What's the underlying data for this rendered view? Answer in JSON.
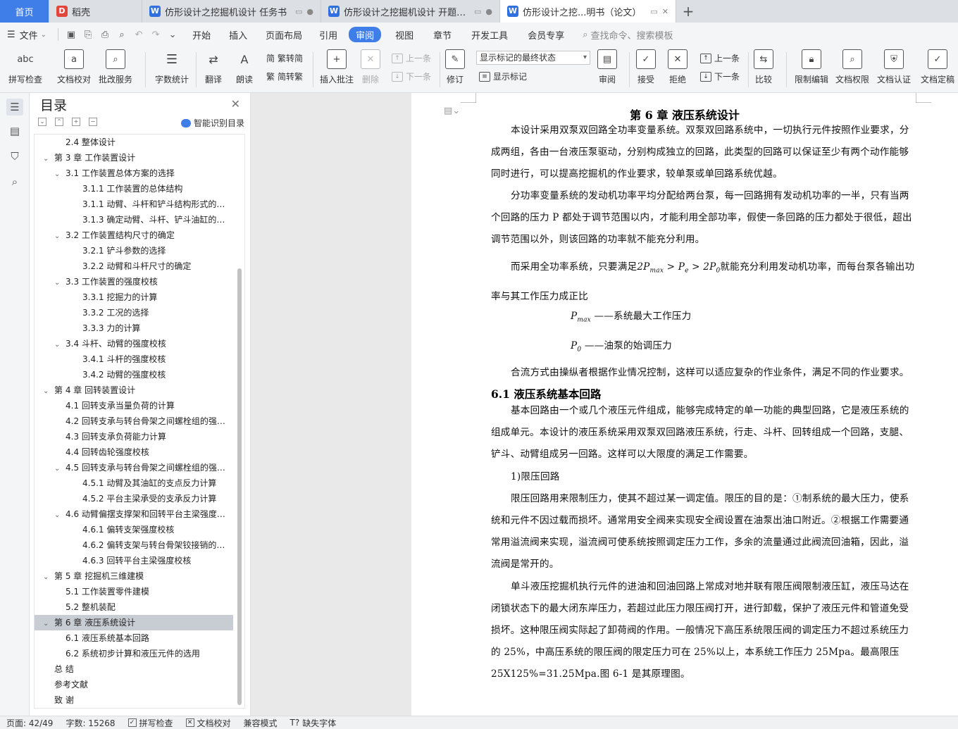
{
  "tabs": {
    "home": "首页",
    "doke": "稻壳",
    "t1": "仿形设计之挖掘机设计 任务书",
    "t2": "仿形设计之挖掘机设计 开题报告",
    "t3": "仿形设计之挖...明书（论文）",
    "doke_icon": "D",
    "word_icon": "W"
  },
  "menubar": {
    "file": "文件",
    "items": [
      "开始",
      "插入",
      "页面布局",
      "引用",
      "审阅",
      "视图",
      "章节",
      "开发工具",
      "会员专享"
    ],
    "active": "审阅",
    "search": "查找命令、搜索模板"
  },
  "ribbon": {
    "spell": "拼写检查",
    "proof": "文档校对",
    "annot_service": "批改服务",
    "wordcount": "字数统计",
    "translate": "翻译",
    "read": "朗读",
    "to_trad": "繁转简",
    "to_simp": "简转繁",
    "insert_comment": "插入批注",
    "delete": "删除",
    "prev": "上一条",
    "next": "下一条",
    "revise": "修订",
    "mark_state": "显示标记的最终状态",
    "show_marks": "显示标记",
    "review": "审阅",
    "accept": "接受",
    "reject": "拒绝",
    "prev2": "上一条",
    "next2": "下一条",
    "compare": "比较",
    "restrict": "限制编辑",
    "perm": "文档权限",
    "cert": "文档认证",
    "final": "文档定稿",
    "spell_icon_text": "abc"
  },
  "toc": {
    "title": "目录",
    "smart": "智能识别目录",
    "items": [
      {
        "level": 2,
        "text": "2.4 整体设计",
        "caret": ""
      },
      {
        "level": 1,
        "text": "第 3 章  工作装置设计",
        "caret": "⌄"
      },
      {
        "level": 2,
        "text": "3.1  工作装置总体方案的选择",
        "caret": "⌄"
      },
      {
        "level": 3,
        "text": "3.1.1 工作装置的总体结构",
        "caret": ""
      },
      {
        "level": 3,
        "text": "3.1.1 动臂、斗杆和铲斗结构形式的选择",
        "caret": ""
      },
      {
        "level": 3,
        "text": "3.1.3 确定动臂、斗杆、铲斗油缸的铰点位置",
        "caret": ""
      },
      {
        "level": 2,
        "text": "3.2 工作装置结构尺寸的确定",
        "caret": "⌄"
      },
      {
        "level": 3,
        "text": "3.2.1 铲斗参数的选择",
        "caret": ""
      },
      {
        "level": 3,
        "text": "3.2.2 动臂和斗杆尺寸的确定",
        "caret": ""
      },
      {
        "level": 2,
        "text": "3.3 工作装置的强度校核",
        "caret": "⌄"
      },
      {
        "level": 3,
        "text": "3.3.1 挖掘力的计算",
        "caret": ""
      },
      {
        "level": 3,
        "text": "3.3.2 工况的选择",
        "caret": ""
      },
      {
        "level": 3,
        "text": "3.3.3 力的计算",
        "caret": ""
      },
      {
        "level": 2,
        "text": "3.4 斗杆、动臂的强度校核",
        "caret": "⌄"
      },
      {
        "level": 3,
        "text": "3.4.1 斗杆的强度校核",
        "caret": ""
      },
      {
        "level": 3,
        "text": "3.4.2 动臂的强度校核",
        "caret": ""
      },
      {
        "level": 1,
        "text": "第 4 章  回转装置设计",
        "caret": "⌄"
      },
      {
        "level": 2,
        "text": "4.1 回转支承当量负荷的计算",
        "caret": ""
      },
      {
        "level": 2,
        "text": "4.2 回转支承与转台骨架之间螺栓组的强度校核",
        "caret": ""
      },
      {
        "level": 2,
        "text": "4.3 回转支承负荷能力计算",
        "caret": ""
      },
      {
        "level": 2,
        "text": "4.4 回转齿轮强度校核",
        "caret": ""
      },
      {
        "level": 2,
        "text": "4.5  回转支承与转台骨架之间螺栓组的强度校核",
        "caret": "⌄"
      },
      {
        "level": 3,
        "text": "4.5.1  动臂及其油缸的支点反力计算",
        "caret": ""
      },
      {
        "level": 3,
        "text": "4.5.2  平台主梁承受的支承反力计算",
        "caret": ""
      },
      {
        "level": 2,
        "text": "4.6 动臂偏摆支撑架和回转平台主梁强度校核",
        "caret": "⌄"
      },
      {
        "level": 3,
        "text": "4.6.1  偏转支架强度校核",
        "caret": ""
      },
      {
        "level": 3,
        "text": "4.6.2  偏转支架与转台骨架铰接销的强度校核",
        "caret": ""
      },
      {
        "level": 3,
        "text": "4.6.3  回转平台主梁强度校核",
        "caret": ""
      },
      {
        "level": 1,
        "text": "第 5 章  挖掘机三维建模",
        "caret": "⌄"
      },
      {
        "level": 2,
        "text": "5.1 工作装置零件建模",
        "caret": ""
      },
      {
        "level": 2,
        "text": "5.2 整机装配",
        "caret": ""
      },
      {
        "level": 1,
        "text": "第 6 章  液压系统设计",
        "caret": "⌄",
        "selected": true
      },
      {
        "level": 2,
        "text": "6.1 液压系统基本回路",
        "caret": ""
      },
      {
        "level": 2,
        "text": "6.2 系统初步计算和液压元件的选用",
        "caret": ""
      },
      {
        "level": 1,
        "text": "总    结",
        "caret": ""
      },
      {
        "level": 1,
        "text": "参考文献",
        "caret": ""
      },
      {
        "level": 1,
        "text": "致    谢",
        "caret": ""
      }
    ]
  },
  "doc": {
    "chapter_title": "第 6 章  液压系统设计",
    "p1": "本设计采用双泵双回路全功率变量系统。双泵双回路系统中，一切执行元件按照作业要求，分成两组，各由一台液压泵驱动，分别构成独立的回路，此类型的回路可以保证至少有两个动作能够同时进行，可以提高挖掘机的作业要求，较单泵或单回路系统优越。",
    "p2": "分功率变量系统的发动机功率平均分配给两台泵，每一回路拥有发动机功率的一半，只有当两个回路的压力 P 都处于调节范围以内，才能利用全部功率，假使一条回路的压力都处于很低，超出调节范围以外，则该回路的功率就不能充分利用。",
    "p3_a": "而采用全功率系统，只要满足",
    "p3_formula": "2P_max > P_e > 2P_0",
    "p3_b": "就能充分利用发动机功率，而每台泵各输出功率与其工作压力成正比",
    "def1_sym": "P",
    "def1_sub": "max",
    "def1_text": " ——系统最大工作压力",
    "def2_sym": "P",
    "def2_sub": "0",
    "def2_text": " ——油泵的始调压力",
    "p4": "合流方式由操纵者根据作业情况控制，这样可以适应复杂的作业条件，满足不同的作业要求。",
    "h2": "6.1 液压系统基本回路",
    "p5": "基本回路由一个或几个液压元件组成，能够完成特定的单一功能的典型回路，它是液压系统的组成单元。本设计的液压系统采用双泵双回路液压系统，行走、斗杆、回转组成一个回路，支腿、铲斗、动臂组成另一回路。这样可以大限度的满足工作需要。",
    "p6": "1)限压回路",
    "p7": "限压回路用来限制压力，使其不超过某一调定值。限压的目的是：①制系统的最大压力，使系统和元件不因过载而损坏。通常用安全阀来实现安全阀设置在油泵出油口附近。②根据工作需要通常用溢流阀来实现，溢流阀可使系统按照调定压力工作，多余的流量通过此阀流回油箱，因此，溢流阀是常开的。",
    "p8": "单斗液压挖掘机执行元件的进油和回油回路上常成对地并联有限压阀限制液压缸，液压马达在闭锁状态下的最大闭东岸压力，若超过此压力限压阀打开，进行卸载，保护了液压元件和管道免受损坏。这种限压阀实际起了卸荷阀的作用。一般情况下高压系统限压阀的调定压力不超过系统压力的 25%，中高压系统的限压阀的限定压力可在 25%以上，本系统工作压力 25Mpa。最高限压 25X125%=31.25Mpa.图 6-1 是其原理图。"
  },
  "status": {
    "page": "页面: 42/49",
    "words": "字数: 15268",
    "spell": "拼写检查",
    "proof": "文档校对",
    "compat": "兼容模式",
    "font": "缺失字体"
  }
}
